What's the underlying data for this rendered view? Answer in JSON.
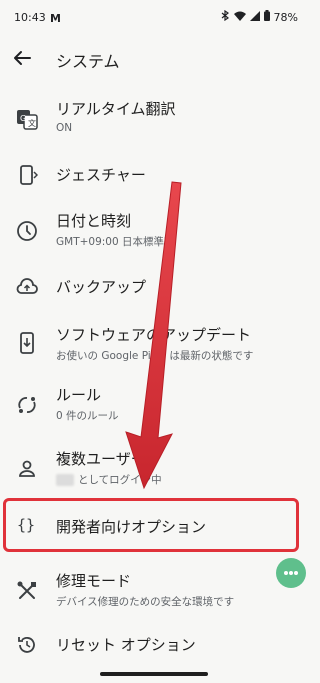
{
  "status_bar": {
    "time": "10:43",
    "notification": "M",
    "battery": "78%"
  },
  "app_bar": {
    "title": "システム"
  },
  "items": [
    {
      "title": "リアルタイム翻訳",
      "subtitle": "ON",
      "icon": "translate-icon"
    },
    {
      "title": "ジェスチャー",
      "subtitle": "",
      "icon": "gesture-icon"
    },
    {
      "title": "日付と時刻",
      "subtitle": "GMT+09:00 日本標準時",
      "icon": "clock-icon"
    },
    {
      "title": "バックアップ",
      "subtitle": "",
      "icon": "cloud-upload-icon"
    },
    {
      "title": "ソフトウェアのアップデート",
      "subtitle": "お使いの Google Pixel は最新の状態です",
      "icon": "phone-download-icon"
    },
    {
      "title": "ルール",
      "subtitle": "0 件のルール",
      "icon": "rules-icon"
    },
    {
      "title": "複数ユーザー",
      "subtitle": "としてログイン中",
      "icon": "person-icon"
    },
    {
      "title": "開発者向けオプション",
      "subtitle": "",
      "icon": "braces-icon"
    },
    {
      "title": "修理モード",
      "subtitle": "デバイス修理のための安全な環境です",
      "icon": "wrench-icon"
    },
    {
      "title": "リセット オプション",
      "subtitle": "",
      "icon": "history-icon"
    }
  ],
  "colors": {
    "background": "#f7f7f5",
    "highlight": "#e0323a",
    "arrow": "#e0323a",
    "fab": "#5fbf8c",
    "text": "#1f1f1f",
    "secondary": "#5f6368"
  }
}
